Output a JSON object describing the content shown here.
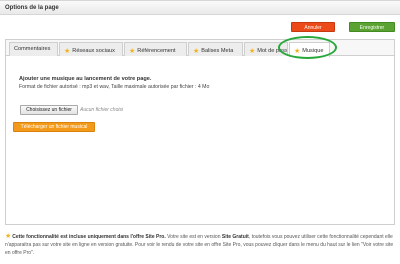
{
  "window": {
    "title": "Options de la page"
  },
  "actions": {
    "cancel": "Annuler",
    "save": "Enregistrer"
  },
  "tabs": [
    {
      "label": "Commentaires",
      "star": false
    },
    {
      "label": "Réseaux sociaux",
      "star": true
    },
    {
      "label": "Référencement",
      "star": true
    },
    {
      "label": "Balises Meta",
      "star": true
    },
    {
      "label": "Mot de pass",
      "star": true
    },
    {
      "label": "Musique",
      "star": true,
      "active": true
    }
  ],
  "music": {
    "heading": "Ajouter une musique au lancement de votre page.",
    "format_note": "Format de fichier autorisé : mp3 et wav, Taille maximale autorisée par fichier : 4 Mo",
    "choose_file": "Choisissez un fichier",
    "no_file": "Aucun fichier choisi",
    "upload": "Télécharger un fichier musical"
  },
  "notice": {
    "part1": "Cette fonctionnalité est incluse uniquement dans l'offre Site Pro.",
    "part2": " Votre site est en version ",
    "part3": "Site Gratuit",
    "part4": ", toutefois vous pouvez utiliser cette fonctionnalité cependant elle n'apparaitra pas sur votre site en ligne en version gratuite. Pour voir le rendu de votre site en offre Site Pro, vous pouvez cliquer dans le menu du haut sur le lien \"Voir votre site en offre Pro\"."
  },
  "colors": {
    "cancel": "#ec4a18",
    "save": "#5aa332",
    "upload": "#f39a1a",
    "highlight": "#27a83a",
    "star": "#f0b21e"
  }
}
